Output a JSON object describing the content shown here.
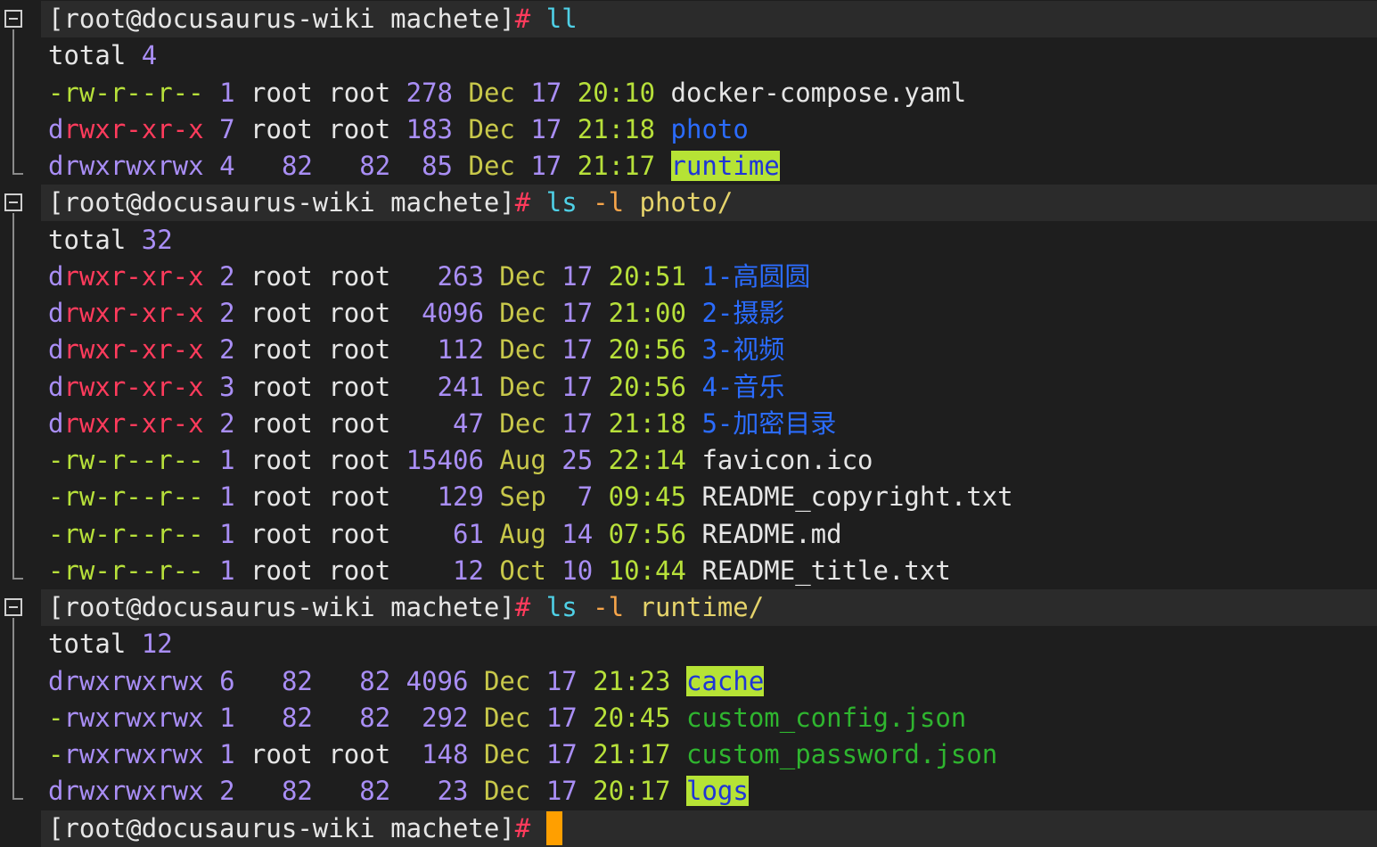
{
  "prompt": {
    "user_host": "[root@docusaurus-wiki machete]",
    "symbol": "#"
  },
  "blocks": [
    {
      "command": {
        "name": "ll",
        "flag": "",
        "arg": ""
      },
      "total_label": "total",
      "total_value": "4",
      "rows": [
        {
          "type": "-",
          "perms": "rw-r--r--",
          "links": "1",
          "owner": "root",
          "group": "root",
          "size": "278",
          "month": "Dec",
          "day": "17",
          "time": "20:10",
          "name": "docker-compose.yaml",
          "kind": "file"
        },
        {
          "type": "d",
          "perms": "rwxr-xr-x",
          "links": "7",
          "owner": "root",
          "group": "root",
          "size": "183",
          "month": "Dec",
          "day": "17",
          "time": "21:18",
          "name": "photo",
          "kind": "dir"
        },
        {
          "type": "d",
          "perms": "rwxrwxrwx",
          "links": "4",
          "owner": "82",
          "group": "82",
          "size": "85",
          "month": "Dec",
          "day": "17",
          "time": "21:17",
          "name": "runtime",
          "kind": "dir-world"
        }
      ]
    },
    {
      "command": {
        "name": "ls",
        "flag": "-l",
        "arg": "photo/"
      },
      "total_label": "total",
      "total_value": "32",
      "rows": [
        {
          "type": "d",
          "perms": "rwxr-xr-x",
          "links": "2",
          "owner": "root",
          "group": "root",
          "size": "263",
          "month": "Dec",
          "day": "17",
          "time": "20:51",
          "name": "1-高圆圆",
          "kind": "dir"
        },
        {
          "type": "d",
          "perms": "rwxr-xr-x",
          "links": "2",
          "owner": "root",
          "group": "root",
          "size": "4096",
          "month": "Dec",
          "day": "17",
          "time": "21:00",
          "name": "2-摄影",
          "kind": "dir"
        },
        {
          "type": "d",
          "perms": "rwxr-xr-x",
          "links": "2",
          "owner": "root",
          "group": "root",
          "size": "112",
          "month": "Dec",
          "day": "17",
          "time": "20:56",
          "name": "3-视频",
          "kind": "dir"
        },
        {
          "type": "d",
          "perms": "rwxr-xr-x",
          "links": "3",
          "owner": "root",
          "group": "root",
          "size": "241",
          "month": "Dec",
          "day": "17",
          "time": "20:56",
          "name": "4-音乐",
          "kind": "dir"
        },
        {
          "type": "d",
          "perms": "rwxr-xr-x",
          "links": "2",
          "owner": "root",
          "group": "root",
          "size": "47",
          "month": "Dec",
          "day": "17",
          "time": "21:18",
          "name": "5-加密目录",
          "kind": "dir"
        },
        {
          "type": "-",
          "perms": "rw-r--r--",
          "links": "1",
          "owner": "root",
          "group": "root",
          "size": "15406",
          "month": "Aug",
          "day": "25",
          "time": "22:14",
          "name": "favicon.ico",
          "kind": "file"
        },
        {
          "type": "-",
          "perms": "rw-r--r--",
          "links": "1",
          "owner": "root",
          "group": "root",
          "size": "129",
          "month": "Sep",
          "day": "7",
          "time": "09:45",
          "name": "README_copyright.txt",
          "kind": "file"
        },
        {
          "type": "-",
          "perms": "rw-r--r--",
          "links": "1",
          "owner": "root",
          "group": "root",
          "size": "61",
          "month": "Aug",
          "day": "14",
          "time": "07:56",
          "name": "README.md",
          "kind": "file"
        },
        {
          "type": "-",
          "perms": "rw-r--r--",
          "links": "1",
          "owner": "root",
          "group": "root",
          "size": "12",
          "month": "Oct",
          "day": "10",
          "time": "10:44",
          "name": "README_title.txt",
          "kind": "file"
        }
      ]
    },
    {
      "command": {
        "name": "ls",
        "flag": "-l",
        "arg": "runtime/"
      },
      "total_label": "total",
      "total_value": "12",
      "rows": [
        {
          "type": "d",
          "perms": "rwxrwxrwx",
          "links": "6",
          "owner": "82",
          "group": "82",
          "size": "4096",
          "month": "Dec",
          "day": "17",
          "time": "21:23",
          "name": "cache",
          "kind": "dir-world"
        },
        {
          "type": "-",
          "perms": "rwxrwxrwx",
          "links": "1",
          "owner": "82",
          "group": "82",
          "size": "292",
          "month": "Dec",
          "day": "17",
          "time": "20:45",
          "name": "custom_config.json",
          "kind": "exec"
        },
        {
          "type": "-",
          "perms": "rwxrwxrwx",
          "links": "1",
          "owner": "root",
          "group": "root",
          "size": "148",
          "month": "Dec",
          "day": "17",
          "time": "21:17",
          "name": "custom_password.json",
          "kind": "exec"
        },
        {
          "type": "d",
          "perms": "rwxrwxrwx",
          "links": "2",
          "owner": "82",
          "group": "82",
          "size": "23",
          "month": "Dec",
          "day": "17",
          "time": "20:17",
          "name": "logs",
          "kind": "dir-world"
        }
      ]
    }
  ],
  "colors": {
    "background": "#1e1e1e",
    "prompt_line_bg": "#2b2b2b",
    "dir": "#2b6cff",
    "dir_world_bg": "#b6e335",
    "exec": "#2fb52f",
    "cursor": "#ff9f00"
  }
}
